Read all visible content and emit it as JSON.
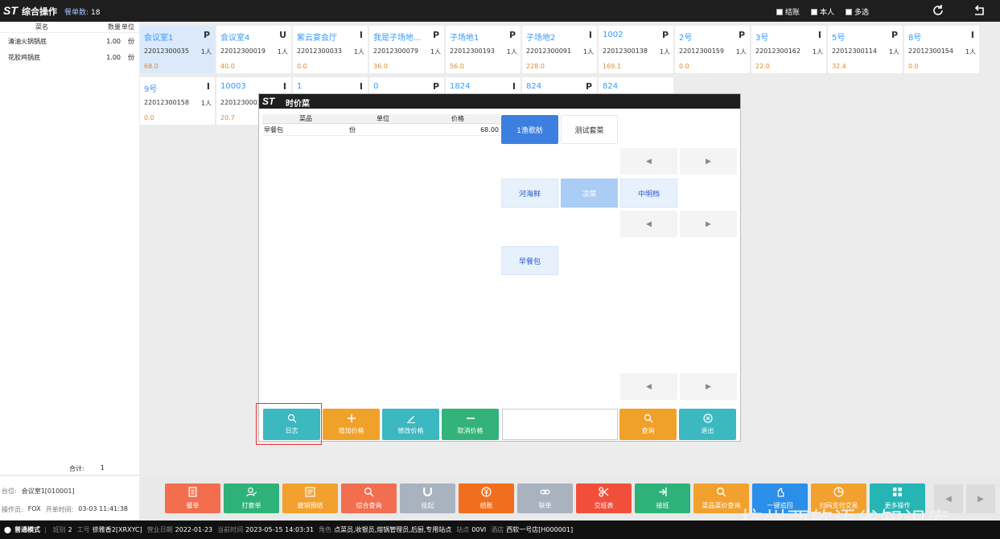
{
  "topbar": {
    "logo": "ST",
    "title": "综合操作",
    "order_count_label": "餐单数:",
    "order_count": "18",
    "checkboxes": [
      "结账",
      "本人",
      "多选"
    ],
    "icons": [
      "refresh-icon",
      "back-icon"
    ]
  },
  "left_panel": {
    "headers": [
      "菜名",
      "数量",
      "单位"
    ],
    "items": [
      {
        "name": "清油火锅锅底",
        "qty": "1.00",
        "unit": "份"
      },
      {
        "name": "花胶鸡锅底",
        "qty": "1.00",
        "unit": "份"
      }
    ],
    "total_label": "合计:",
    "total_value": "1",
    "table_label": "台位:",
    "table_value": "会议室1[010001]",
    "operator_label": "操作员:",
    "operator_value": "FOX",
    "open_time_label": "开单时间:",
    "open_time_value": "03-03 11:41:38"
  },
  "tables": [
    {
      "name": "会议室1",
      "status": "P",
      "no": "22012300035",
      "people": "1人",
      "amount": "68.0"
    },
    {
      "name": "会议室4",
      "status": "U",
      "no": "22012300019",
      "people": "1人",
      "amount": "40.0"
    },
    {
      "name": "紫云宴会厅",
      "status": "I",
      "no": "22012300033",
      "people": "1人",
      "amount": "0.0"
    },
    {
      "name": "我是子场地...",
      "status": "P",
      "no": "22012300079",
      "people": "1人",
      "amount": "36.0"
    },
    {
      "name": "子场地1",
      "status": "P",
      "no": "22012300193",
      "people": "1人",
      "amount": "56.0"
    },
    {
      "name": "子场地2",
      "status": "I",
      "no": "22012300091",
      "people": "1人",
      "amount": "228.0"
    },
    {
      "name": "1002",
      "status": "P",
      "no": "22012300138",
      "people": "1人",
      "amount": "169.1"
    },
    {
      "name": "2号",
      "status": "P",
      "no": "22012300159",
      "people": "1人",
      "amount": "0.0"
    },
    {
      "name": "3号",
      "status": "I",
      "no": "22012300162",
      "people": "1人",
      "amount": "22.0"
    },
    {
      "name": "5号",
      "status": "P",
      "no": "22012300114",
      "people": "1人",
      "amount": "32.4"
    },
    {
      "name": "8号",
      "status": "I",
      "no": "22012300154",
      "people": "1人",
      "amount": "0.0"
    },
    {
      "name": "9号",
      "status": "I",
      "no": "22012300158",
      "people": "1人",
      "amount": "0.0"
    },
    {
      "name": "10003",
      "status": "I",
      "no": "22012300036",
      "people": "",
      "amount": "20.7"
    },
    {
      "name": "1",
      "status": "I",
      "no": "",
      "people": "",
      "amount": ""
    },
    {
      "name": "0",
      "status": "P",
      "no": "",
      "people": "",
      "amount": ""
    },
    {
      "name": "1824",
      "status": "I",
      "no": "",
      "people": "",
      "amount": ""
    },
    {
      "name": "824",
      "status": "P",
      "no": "",
      "people": "",
      "amount": ""
    },
    {
      "name": "824",
      "status": "",
      "no": "",
      "people": "",
      "amount": ""
    }
  ],
  "dialog": {
    "logo": "ST",
    "title": "时价菜",
    "headers": [
      "菜品",
      "单位",
      "价格"
    ],
    "rows": [
      {
        "name": "早餐包",
        "unit": "份",
        "price": "68.00"
      }
    ],
    "categories": [
      "1渔歌舫",
      "测试套菜"
    ],
    "dishes_row1": [
      "河海鲜",
      "凉菜",
      "中明档"
    ],
    "dishes_row2": [
      "早餐包"
    ],
    "actions": [
      {
        "label": "日志",
        "icon": "search-icon",
        "color": "#3cb8c0"
      },
      {
        "label": "增加价格",
        "icon": "plus-icon",
        "color": "#f0a12a"
      },
      {
        "label": "修改价格",
        "icon": "edit-icon",
        "color": "#3cb8c0"
      },
      {
        "label": "取消价格",
        "icon": "minus-icon",
        "color": "#33b37a"
      },
      {
        "label": "查询",
        "icon": "search-icon",
        "color": "#f0a12a"
      },
      {
        "label": "退出",
        "icon": "close-icon",
        "color": "#3cb8c0"
      }
    ]
  },
  "bottom_buttons": [
    {
      "label": "餐单",
      "icon": "menu-icon",
      "color": "#f26e4f"
    },
    {
      "label": "打套单",
      "icon": "person-icon",
      "color": "#2fb279"
    },
    {
      "label": "撤销预结",
      "icon": "note-icon",
      "color": "#f2a12e"
    },
    {
      "label": "综合查询",
      "icon": "search-icon",
      "color": "#f26e4f"
    },
    {
      "label": "挂起",
      "icon": "magnet-icon",
      "color": "#a9b2bf"
    },
    {
      "label": "结账",
      "icon": "yen-icon",
      "color": "#f26e1f"
    },
    {
      "label": "联单",
      "icon": "link-icon",
      "color": "#a9b2bf"
    },
    {
      "label": "交班表",
      "icon": "scissors-icon",
      "color": "#f24f3a"
    },
    {
      "label": "接班",
      "icon": "handover-icon",
      "color": "#2fb279"
    },
    {
      "label": "菜品菜价查询",
      "icon": "search-icon",
      "color": "#f2a12e"
    },
    {
      "label": "一键追回",
      "icon": "hand-icon",
      "color": "#2a8fe8"
    },
    {
      "label": "扫码支付交易",
      "icon": "pie-icon",
      "color": "#f2a12e"
    },
    {
      "label": "更多操作",
      "icon": "grid-icon",
      "color": "#26b5b5"
    }
  ],
  "status_bar": {
    "mode": "普通模式",
    "fields": [
      {
        "label": "班别",
        "value": "2"
      },
      {
        "label": "工号",
        "value": "徐雅香2[XRXYC]"
      },
      {
        "label": "营业日期",
        "value": "2022-01-23"
      },
      {
        "label": "当前时间",
        "value": "2023-05-15 14:03:31"
      },
      {
        "label": "角色",
        "value": "点菜员,收银员,熔锅管理员,后厨,专用站点"
      },
      {
        "label": "站点",
        "value": "00VI"
      },
      {
        "label": "酒店",
        "value": "西软一号店[H000001]"
      }
    ]
  },
  "watermark": "杭州西软语雀知识库"
}
